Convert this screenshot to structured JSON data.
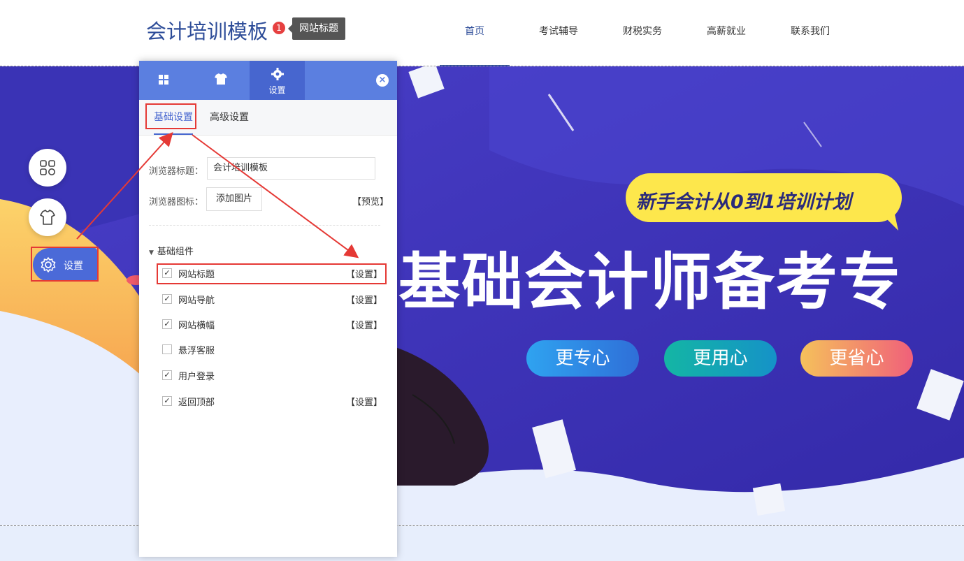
{
  "header": {
    "site_title": "会计培训模板",
    "badge": "1",
    "tooltip": "网站标题",
    "nav": [
      "首页",
      "考试辅导",
      "财税实务",
      "高薪就业",
      "联系我们"
    ]
  },
  "banner": {
    "slogan": "新手会计从0到1培训计划",
    "headline": "基础会计师备考专",
    "buttons": [
      "更专心",
      "更用心",
      "更省心"
    ]
  },
  "float_menu": {
    "settings_label": "设置"
  },
  "panel": {
    "tabs": [
      {
        "icon": "grid-icon",
        "label": ""
      },
      {
        "icon": "tshirt-icon",
        "label": ""
      },
      {
        "icon": "gear-icon",
        "label": "设置"
      }
    ],
    "subtabs": [
      "基础设置",
      "高级设置"
    ],
    "browser_title_label": "浏览器标题：",
    "browser_title_value": "会计培训模板",
    "browser_icon_label": "浏览器图标：",
    "add_image": "添加图片",
    "preview": "【预览】",
    "group_title": "基础组件",
    "components": [
      {
        "label": "网站标题",
        "checked": true,
        "link": "【设置】"
      },
      {
        "label": "网站导航",
        "checked": true,
        "link": "【设置】"
      },
      {
        "label": "网站横幅",
        "checked": true,
        "link": "【设置】"
      },
      {
        "label": "悬浮客服",
        "checked": false,
        "link": ""
      },
      {
        "label": "用户登录",
        "checked": true,
        "link": ""
      },
      {
        "label": "返回顶部",
        "checked": true,
        "link": "【设置】"
      }
    ]
  },
  "colors": {
    "accent": "#4766cf",
    "banner_bg": "#3d3ab8",
    "highlight": "#e53935"
  }
}
